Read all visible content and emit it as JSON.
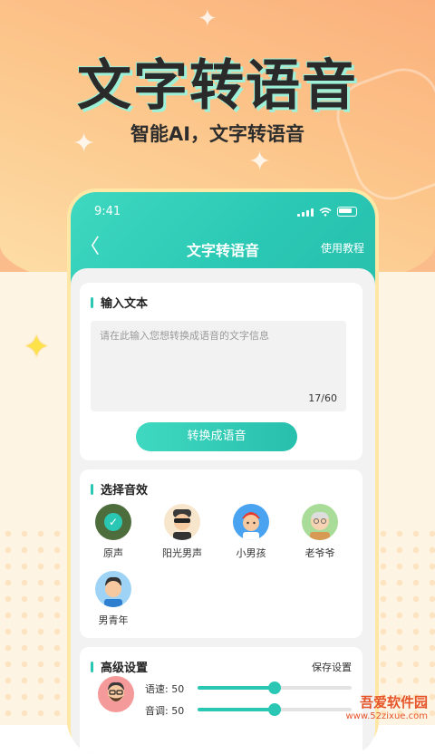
{
  "promo": {
    "headline": "文字转语音",
    "subline": "智能AI，文字转语音"
  },
  "status_bar": {
    "time": "9:41"
  },
  "nav": {
    "back_icon": "chevron-left-icon",
    "back_glyph": "〈",
    "title": "文字转语音",
    "help": "使用教程"
  },
  "input_section": {
    "title": "输入文本",
    "placeholder": "请在此输入您想转换成语音的文字信息",
    "counter": "17/60",
    "convert_button": "转换成语音"
  },
  "voice_section": {
    "title": "选择音效",
    "voices": [
      {
        "name": "原声",
        "selected": true,
        "color": "#4e6d3d"
      },
      {
        "name": "阳光男声",
        "selected": false,
        "color": "#f7e6cc"
      },
      {
        "name": "小男孩",
        "selected": false,
        "color": "#4aa3f0"
      },
      {
        "name": "老爷爷",
        "selected": false,
        "color": "#a9dc98"
      },
      {
        "name": "男青年",
        "selected": false,
        "color": "#9fd3f5"
      }
    ]
  },
  "advanced_section": {
    "title": "高级设置",
    "save": "保存设置",
    "speed": {
      "label": "语速:",
      "value": "50",
      "level": 0.5
    },
    "tone": {
      "label": "音调:",
      "value": "50",
      "level": 0.5
    }
  },
  "watermark": {
    "title": "吾爱软件园",
    "url": "www.52zixue.com"
  },
  "colors": {
    "accent": "#2ac8b4",
    "headline_shadow": "#9ef1d8"
  }
}
